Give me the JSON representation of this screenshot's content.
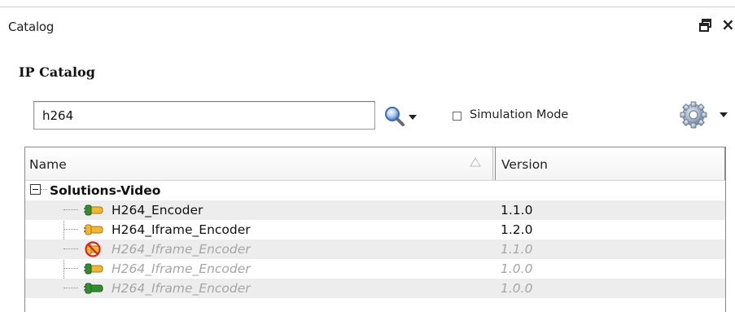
{
  "panel": {
    "title": "Catalog"
  },
  "section": {
    "title": "IP Catalog"
  },
  "search": {
    "value": "h264"
  },
  "simulation_mode": {
    "label": "Simulation Mode",
    "checked": false
  },
  "table": {
    "columns": {
      "name": "Name",
      "version": "Version"
    },
    "group": {
      "name": "Solutions-Video",
      "expanded": true
    },
    "rows": [
      {
        "name": "H264_Encoder",
        "version": "1.1.0",
        "icon": "ip-core-icon",
        "disabled": false
      },
      {
        "name": "H264_Iframe_Encoder",
        "version": "1.2.0",
        "icon": "ip-core-icon",
        "disabled": false
      },
      {
        "name": "H264_Iframe_Encoder",
        "version": "1.1.0",
        "icon": "ip-core-prohibited-icon",
        "disabled": true
      },
      {
        "name": "H264_Iframe_Encoder",
        "version": "1.0.0",
        "icon": "ip-core-icon",
        "disabled": true
      },
      {
        "name": "H264_Iframe_Encoder",
        "version": "1.0.0",
        "icon": "ip-core-icon",
        "disabled": true
      }
    ]
  },
  "colors": {
    "disabled_text": "#a6a6a6",
    "row_shade": "#ededed",
    "plug_body": "#f2b632",
    "plug_cap": "#2f8f2f",
    "prohibited": "#d9261c"
  },
  "icons": {
    "restore": "restore-window-icon",
    "close": "close-icon",
    "search": "magnifier-icon",
    "search_dropdown": "dropdown-arrow-icon",
    "settings": "gear-icon",
    "settings_dropdown": "dropdown-arrow-icon",
    "sort": "sort-ascending-icon"
  }
}
